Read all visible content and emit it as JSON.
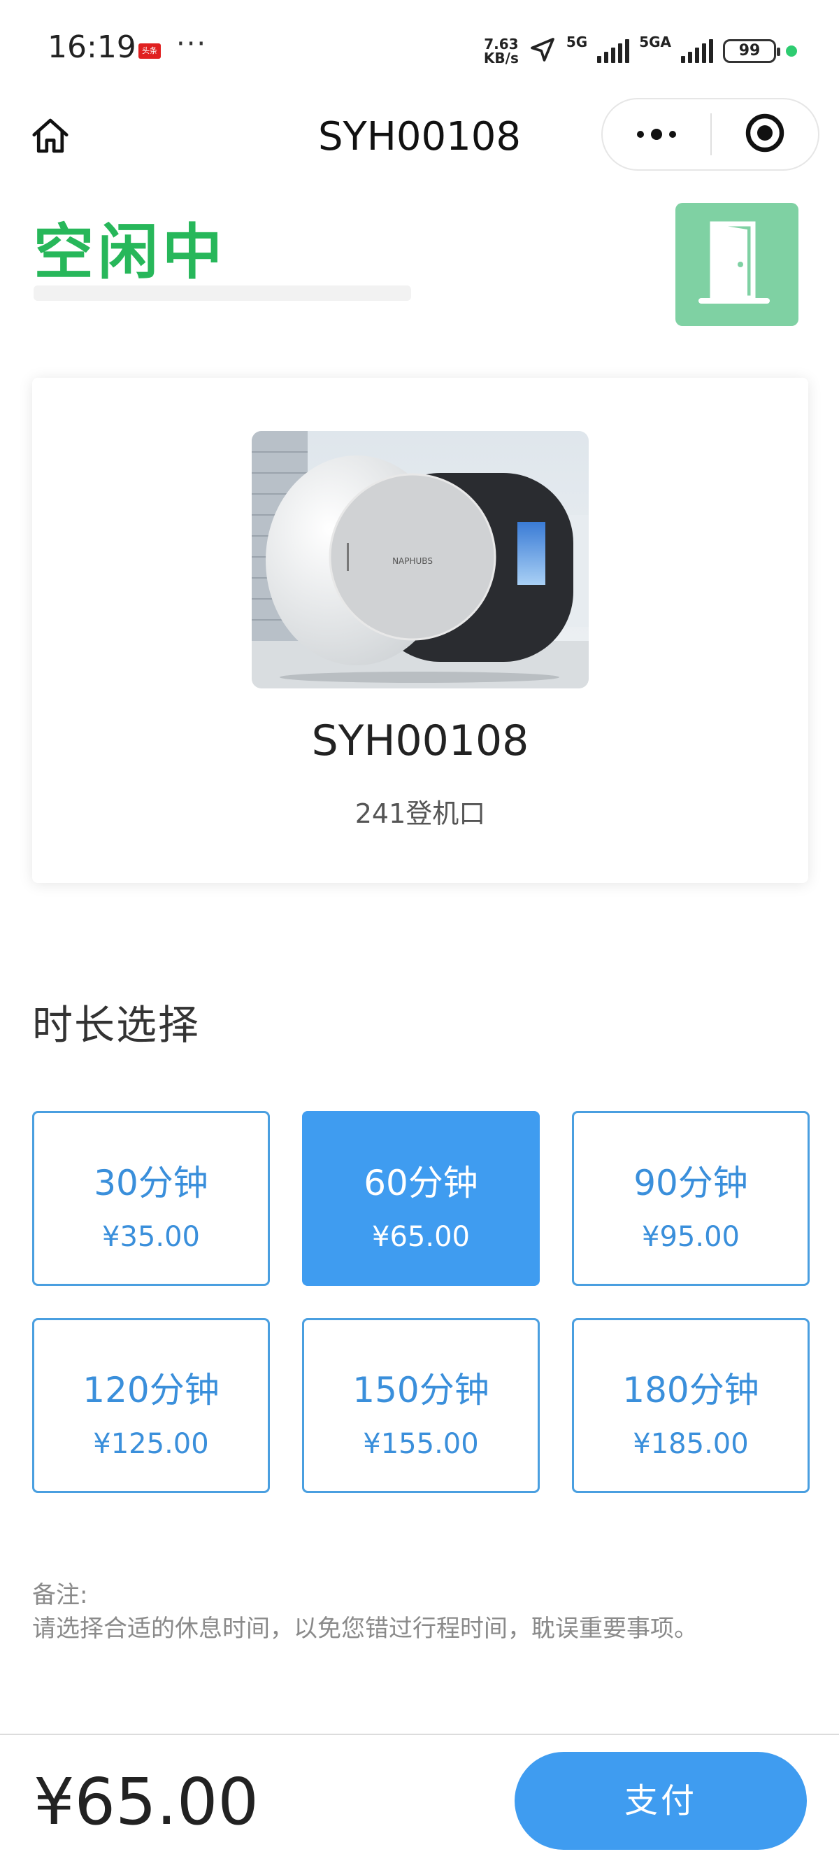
{
  "status_bar": {
    "time": "16:19",
    "app_badge": "头条",
    "more_dots": "···",
    "net_speed_value": "7.63",
    "net_speed_unit": "KB/s",
    "signal1_label": "5G",
    "signal2_label": "5GA",
    "battery": "99"
  },
  "nav": {
    "title": "SYH00108"
  },
  "status": {
    "label": "空闲中",
    "accent_color": "#27b75a",
    "door_button_color": "#7fd1a3"
  },
  "device": {
    "name": "SYH00108",
    "location": "241登机口",
    "brand": "NAPHUBS"
  },
  "duration": {
    "title": "时长选择",
    "selected_index": 1,
    "options": [
      {
        "label": "30分钟",
        "price": "¥35.00"
      },
      {
        "label": "60分钟",
        "price": "¥65.00"
      },
      {
        "label": "90分钟",
        "price": "¥95.00"
      },
      {
        "label": "120分钟",
        "price": "¥125.00"
      },
      {
        "label": "150分钟",
        "price": "¥155.00"
      },
      {
        "label": "180分钟",
        "price": "¥185.00"
      }
    ]
  },
  "note": {
    "title": "备注:",
    "text": "请选择合适的休息时间，以免您错过行程时间，耽误重要事项。"
  },
  "checkout": {
    "total": "¥65.00",
    "pay_label": "支付",
    "primary_color": "#3f9cf0"
  }
}
